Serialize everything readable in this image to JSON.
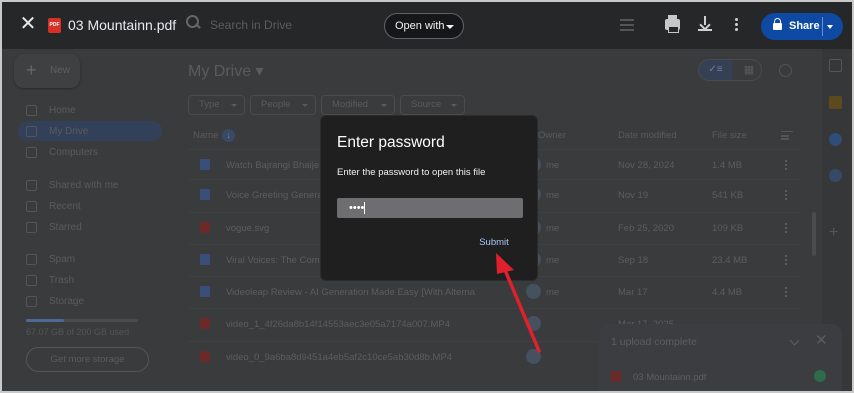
{
  "viewer": {
    "file_title": "03 Mountainn.pdf",
    "pdf_badge": "PDF",
    "search_placeholder": "Search in Drive",
    "open_with_label": "Open with",
    "share_label": "Share",
    "icons": [
      "close-icon",
      "pdf-file-icon",
      "search-icon",
      "tune-icon",
      "print-icon",
      "download-icon",
      "more-vert-icon",
      "lock-icon",
      "chevron-down-icon"
    ]
  },
  "sidebar": {
    "new_label": "New",
    "items": [
      {
        "label": "Home",
        "icon": "home-icon"
      },
      {
        "label": "My Drive",
        "icon": "drive-icon"
      },
      {
        "label": "Computers",
        "icon": "computer-icon"
      },
      {
        "label": "Shared with me",
        "icon": "people-icon"
      },
      {
        "label": "Recent",
        "icon": "clock-icon"
      },
      {
        "label": "Starred",
        "icon": "star-icon"
      },
      {
        "label": "Spam",
        "icon": "spam-icon"
      },
      {
        "label": "Trash",
        "icon": "trash-icon"
      },
      {
        "label": "Storage",
        "icon": "cloud-icon"
      }
    ],
    "storage_text": "67.07 GB of 200 GB used",
    "storage_fraction": 0.34,
    "get_storage_label": "Get more storage"
  },
  "main": {
    "title": "My Drive",
    "filters": [
      "Type",
      "People",
      "Modified",
      "Source"
    ],
    "columns": {
      "name": "Name",
      "owner": "Owner",
      "date": "Date modified",
      "size": "File size"
    },
    "rows": [
      {
        "name": "Watch Bajrangi Bhaije",
        "owner": "me",
        "date": "Nov 28, 2024",
        "size": "1.4 MB",
        "type": "doc"
      },
      {
        "name": "Voice Greeting Genera",
        "owner": "me",
        "date": "Nov 19",
        "size": "541 KB",
        "type": "doc"
      },
      {
        "name": "vogue.svg",
        "owner": "me",
        "date": "Feb 25, 2020",
        "size": "109 KB",
        "type": "image"
      },
      {
        "name": "Viral Voices: The Com",
        "owner": "me",
        "date": "Sep 18",
        "size": "23.4 MB",
        "type": "doc"
      },
      {
        "name": "Videoleap Review - AI Generation Made Easy [With Alterna",
        "owner": "me",
        "date": "Mar 17",
        "size": "4.4 MB",
        "type": "doc"
      },
      {
        "name": "video_1_4f26da8b14f14553aec3e05a7174a007.MP4",
        "owner": "",
        "date": "Mar 17, 2025",
        "size": "",
        "type": "video"
      },
      {
        "name": "video_0_9a6ba8d9451a4eb5af2c10ce5ab30d8b.MP4",
        "owner": "",
        "date": "",
        "size": "",
        "type": "video"
      }
    ]
  },
  "upload_panel": {
    "title": "1 upload complete",
    "file": "03 Mountainn.pdf"
  },
  "dialog": {
    "title": "Enter password",
    "message": "Enter the password to open this file",
    "password_value": "••••",
    "submit_label": "Submit"
  },
  "colors": {
    "dialog_bg": "#1f1f20",
    "submit_text": "#a8c7fa",
    "share_bg": "#0e4aa3",
    "arrow": "#e0202a"
  }
}
